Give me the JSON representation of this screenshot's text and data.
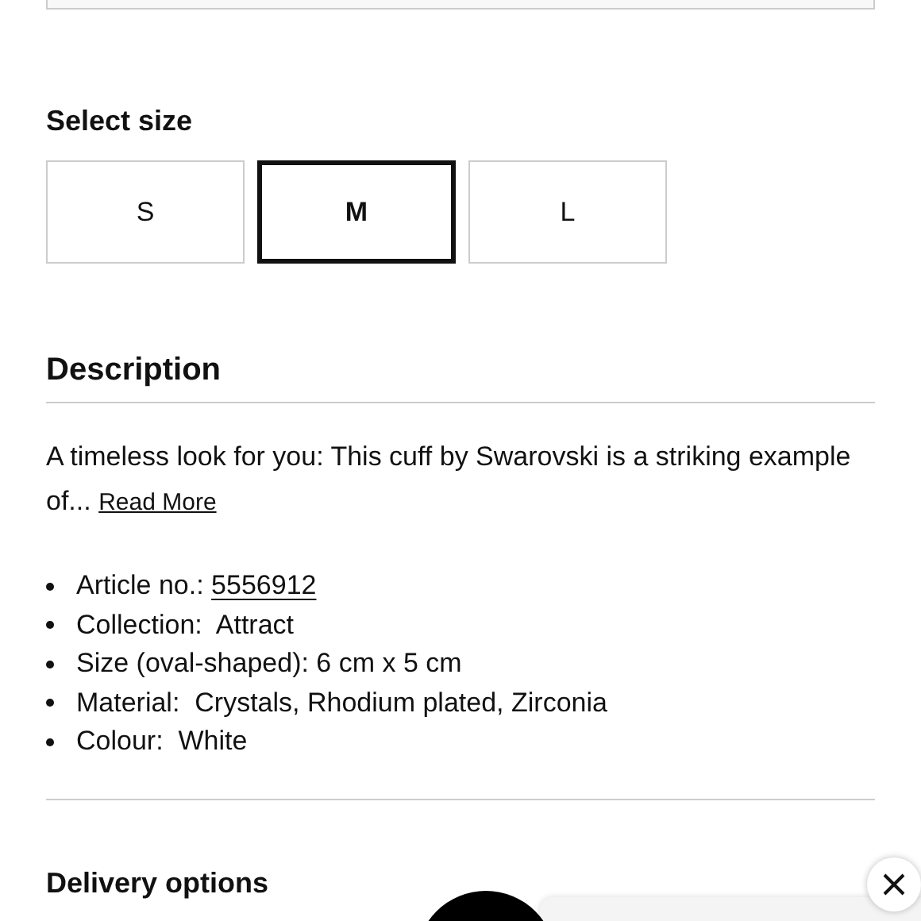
{
  "size_selector": {
    "title": "Select size",
    "options": [
      {
        "label": "S",
        "selected": false
      },
      {
        "label": "M",
        "selected": true
      },
      {
        "label": "L",
        "selected": false
      }
    ]
  },
  "description": {
    "title": "Description",
    "text": "A timeless look for you: This cuff by Swarovski is a striking example of...",
    "read_more": "Read More",
    "details": [
      {
        "label": "Article no.:",
        "value": "5556912",
        "linked": true
      },
      {
        "label": "Collection:",
        "value": " Attract",
        "linked": false
      },
      {
        "label": "Size (oval-shaped):",
        "value": "6 cm x 5 cm",
        "linked": false
      },
      {
        "label": "Material:",
        "value": " Crystals, Rhodium plated, Zirconia",
        "linked": false
      },
      {
        "label": "Colour:",
        "value": " White",
        "linked": false
      }
    ]
  },
  "delivery": {
    "title": "Delivery options"
  }
}
